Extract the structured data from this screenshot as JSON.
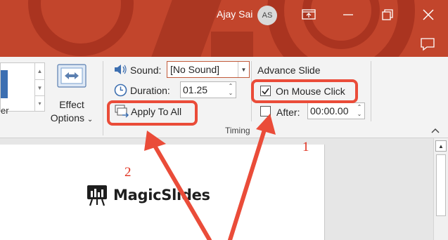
{
  "titlebar": {
    "user_name": "Ajay Sai",
    "user_initials": "AS",
    "bg_color": "#c2452c",
    "buttons": [
      "restore-to-ribbon-icon",
      "restore-icon",
      "close-icon"
    ]
  },
  "ribbon": {
    "gallery": {
      "item_label": "er"
    },
    "effect_options": {
      "label_line1": "Effect",
      "label_line2": "Options"
    },
    "sound": {
      "label": "Sound:",
      "value": "[No Sound]"
    },
    "duration": {
      "label": "Duration:",
      "value": "01.25"
    },
    "apply_to_all": {
      "label": "Apply To All"
    },
    "advance": {
      "title": "Advance Slide",
      "on_mouse_click": {
        "label": "On Mouse Click",
        "checked": true
      },
      "after": {
        "label": "After:",
        "value": "00:00.00",
        "checked": false
      }
    },
    "group_label": "Timing"
  },
  "slide": {
    "logo_text": "MagicSlides"
  },
  "annotations": {
    "number_1": "1",
    "number_2": "2",
    "accent_color": "#ea4c39"
  }
}
